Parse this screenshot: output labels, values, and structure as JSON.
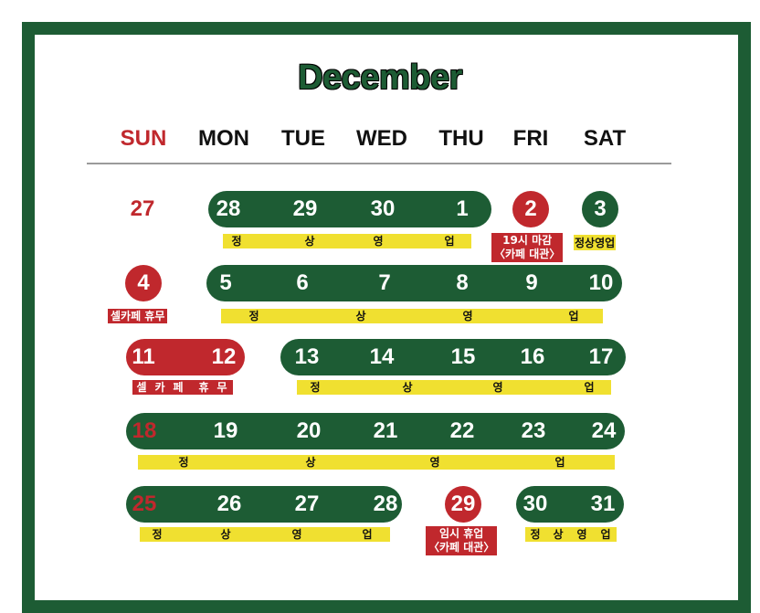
{
  "month": "December",
  "weekdays": [
    "SUN",
    "MON",
    "TUE",
    "WED",
    "THU",
    "FRI",
    "SAT"
  ],
  "rows": [
    {
      "days": [
        "27",
        "28",
        "29",
        "30",
        "1",
        "2",
        "3"
      ]
    },
    {
      "days": [
        "4",
        "5",
        "6",
        "7",
        "8",
        "9",
        "10"
      ]
    },
    {
      "days": [
        "11",
        "12",
        "13",
        "14",
        "15",
        "16",
        "17"
      ]
    },
    {
      "days": [
        "18",
        "19",
        "20",
        "21",
        "22",
        "23",
        "24"
      ]
    },
    {
      "days": [
        "25",
        "26",
        "27",
        "28",
        "29",
        "30",
        "31"
      ]
    }
  ],
  "labels": {
    "open_chars": [
      "정",
      "상",
      "영",
      "업"
    ],
    "open_full": "정상영업",
    "close_19": "19시 마감",
    "cafe_rental": "〈카페 대관〉",
    "cell_cafe_closed": "셀카페 휴무",
    "cell_cafe_closed_spaced": [
      "셀",
      "카",
      "페",
      "휴",
      "무"
    ],
    "temp_closed": "임시 휴업"
  },
  "colors": {
    "green": "#1d5c34",
    "red": "#c0282d",
    "yellow": "#f0e030"
  }
}
